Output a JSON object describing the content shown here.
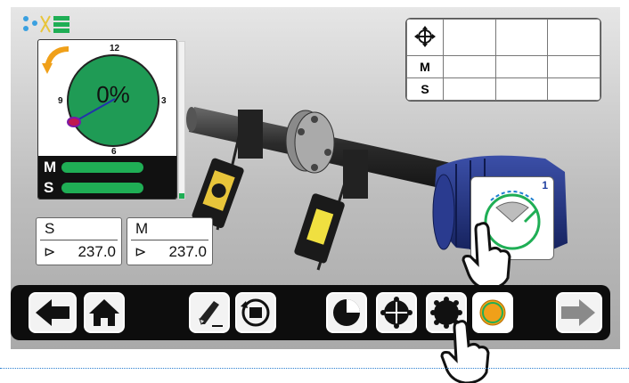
{
  "status": {
    "icons": [
      "connection-dots-icon",
      "battery-icon"
    ]
  },
  "gauge": {
    "value": "0%",
    "clock": {
      "top": "12",
      "right": "3",
      "bottom": "6",
      "left": "9"
    },
    "rows": [
      {
        "label": "M",
        "fill_fraction": 1.0
      },
      {
        "label": "S",
        "fill_fraction": 1.0
      }
    ],
    "colors": {
      "fill": "#1f9b55",
      "bar": "#1fae55",
      "arrow": "#f0a019",
      "needle": "#c0184f"
    }
  },
  "result_table": {
    "rows": [
      {
        "label": "",
        "icon": "crosshair-icon",
        "cells": [
          "",
          "",
          ""
        ]
      },
      {
        "label": "M",
        "cells": [
          "",
          "",
          ""
        ]
      },
      {
        "label": "S",
        "cells": [
          "",
          "",
          ""
        ]
      }
    ]
  },
  "values": {
    "s": {
      "name": "S",
      "value": "237.0"
    },
    "m": {
      "name": "M",
      "value": "237.0"
    }
  },
  "popup": {
    "number": "1",
    "icon": "sweep-measurement-icon"
  },
  "toolbar": {
    "buttons": [
      "back-arrow-icon",
      "home-icon",
      "pencil-icon",
      "machine-rotate-icon",
      "clock-method-icon",
      "multipoint-icon",
      "continuous-sweep-icon",
      "sweep-icon",
      "forward-arrow-icon"
    ],
    "active": "sweep-icon",
    "accent": "#f0a019"
  }
}
